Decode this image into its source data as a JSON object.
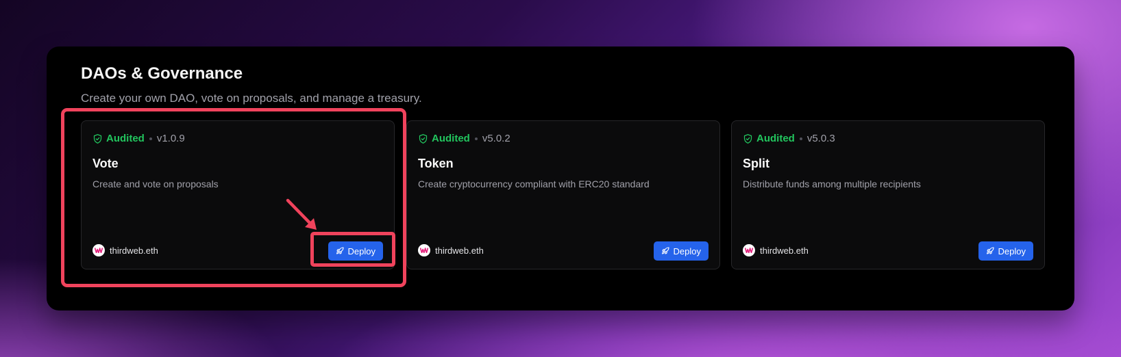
{
  "section": {
    "title": "DAOs & Governance",
    "subtitle": "Create your own DAO, vote on proposals, and manage a treasury."
  },
  "cards": [
    {
      "audited_label": "Audited",
      "version": "v1.0.9",
      "title": "Vote",
      "description": "Create and vote on proposals",
      "publisher": "thirdweb.eth",
      "deploy_label": "Deploy"
    },
    {
      "audited_label": "Audited",
      "version": "v5.0.2",
      "title": "Token",
      "description": "Create cryptocurrency compliant with ERC20 standard",
      "publisher": "thirdweb.eth",
      "deploy_label": "Deploy"
    },
    {
      "audited_label": "Audited",
      "version": "v5.0.3",
      "title": "Split",
      "description": "Distribute funds among multiple recipients",
      "publisher": "thirdweb.eth",
      "deploy_label": "Deploy"
    }
  ],
  "icons": {
    "audited": "shield-check-icon",
    "publisher": "thirdweb-logo-icon",
    "deploy": "rocket-icon"
  },
  "colors": {
    "audited": "#22c55e",
    "deploy_button": "#2563eb",
    "highlight": "#f0435c",
    "thirdweb_logo": "#e31c79"
  }
}
